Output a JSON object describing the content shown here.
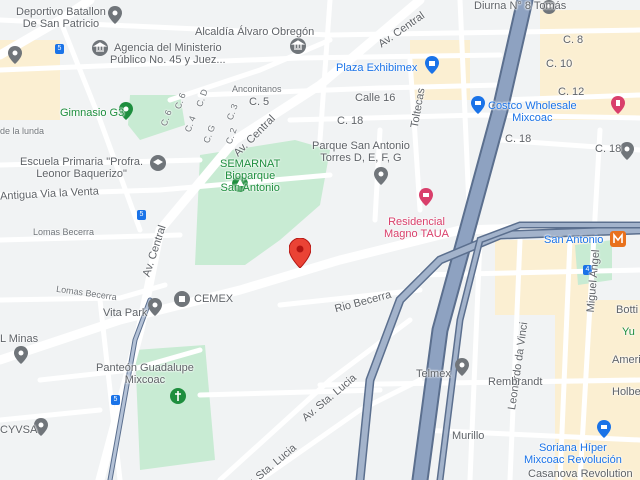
{
  "colors": {
    "background": "#f1f3f4",
    "park": "#c8ebd3",
    "highway": "#7d93b2",
    "highway_edge": "#5b6f8e",
    "road": "#ffffff",
    "commercial": "#fbefd2",
    "poi_gray": "#70757a",
    "poi_green": "#1e8e3e",
    "poi_blue": "#1a73e8",
    "poi_pink": "#d93f6b",
    "marker_red": "#ea4335",
    "metro_orange": "#e8711c"
  },
  "places": {
    "deportivo": "Deportivo Batallon\nDe San Patricio",
    "alcaldia": "Alcaldía Álvaro Obregón",
    "agencia": "Agencia del Ministerio\nPúblico No. 45 y Juez...",
    "diurna": "Diurna N° 8 Tomás",
    "plaza": "Plaza Exhibimex",
    "costco": "Costco Wholesale\nMixcoac",
    "gimnasio": "Gimnasio G3",
    "parque": "Parque San Antonio\nTorres D, E, F, G",
    "escuela": "Escuela Primaria \"Profra.\nLeonor Baquerizo\"",
    "semarnat": "SEMARNAT\nBioparque\nSan Antonio",
    "residencial": "Residencial\nMagno TAUA",
    "san_antonio": "San Antonio",
    "vita_park": "Vita Park",
    "cemex": "CEMEX",
    "l_minas": "L Minas",
    "panteon": "Panteón Guadalupe\nMixcoac",
    "telmex": "Telmex",
    "cyvsa": "CYVSA",
    "soriana": "Soriana Híper\nMixcoac Revolución",
    "casanova": "Casanova Revolution",
    "botti": "Botti",
    "yu": "Yu",
    "ameri": "Ameri",
    "holbei": "Holbei"
  },
  "streets": {
    "av_central_top": "Av. Central",
    "av_central_mid": "Av. Central",
    "av_central_left": "Av. Central",
    "calle16": "Calle 16",
    "c18": "C. 18",
    "c18b": "C. 18",
    "c18c": "C. 18",
    "c5": "C. 5",
    "c8": "C. 8",
    "c10": "C. 10",
    "c12": "C. 12",
    "tolteca": "Toltecas",
    "anconitanos": "Anconitanos",
    "antigua": "Antigua Via la Venta",
    "lomas_becerra": "Lomas Becerra",
    "lomas_becerra2": "Lomas Becerra",
    "rio_becerra": "Rio Becerra",
    "leonardo": "Leonardo da Vinci",
    "miguel": "Miguel Angel",
    "rembrandt": "Rembrandt",
    "murillo": "Murillo",
    "av_sta_lucia": "Av. Sta. Lucia",
    "av_sta_lucia2": "Av. Sta. Lucia",
    "c6": "C. 6",
    "c3": "C. 3",
    "c4": "C. 4",
    "c2": "C. 2",
    "c6b": "C. 6",
    "c_d": "C. D",
    "c_g": "C. G",
    "lunda": "de la lunda"
  },
  "shields": {
    "s5a": "5",
    "s5b": "5",
    "s5c": "5",
    "s4": "4"
  }
}
